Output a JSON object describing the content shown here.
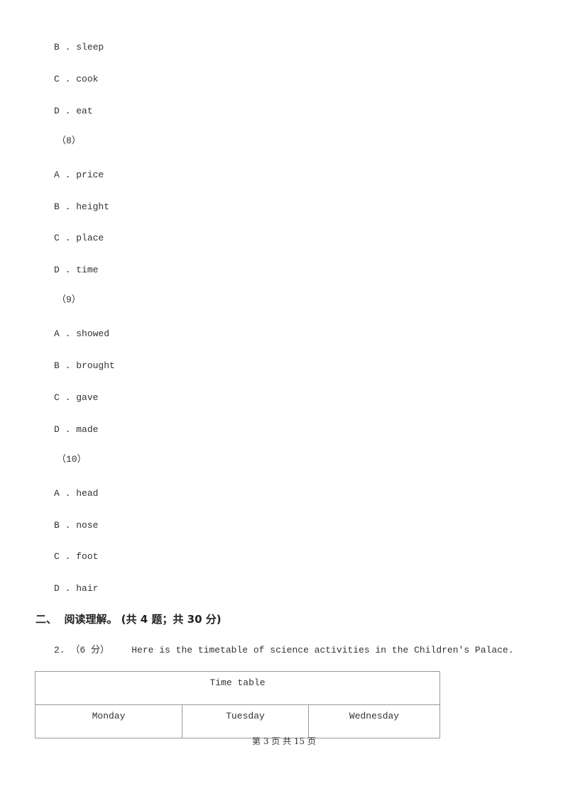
{
  "questions": [
    {
      "options": [
        {
          "letter": "B .",
          "text": "sleep"
        },
        {
          "letter": "C .",
          "text": "cook"
        },
        {
          "letter": "D .",
          "text": "eat"
        }
      ]
    },
    {
      "number": "（8）",
      "options": [
        {
          "letter": "A .",
          "text": "price"
        },
        {
          "letter": "B .",
          "text": "height"
        },
        {
          "letter": "C .",
          "text": "place"
        },
        {
          "letter": "D .",
          "text": "time"
        }
      ]
    },
    {
      "number": "（9）",
      "options": [
        {
          "letter": "A .",
          "text": "showed"
        },
        {
          "letter": "B .",
          "text": "brought"
        },
        {
          "letter": "C .",
          "text": "gave"
        },
        {
          "letter": "D .",
          "text": "made"
        }
      ]
    },
    {
      "number": "（10）",
      "options": [
        {
          "letter": "A .",
          "text": "head"
        },
        {
          "letter": "B .",
          "text": "nose"
        },
        {
          "letter": "C .",
          "text": "foot"
        },
        {
          "letter": "D .",
          "text": "hair"
        }
      ]
    }
  ],
  "section": {
    "heading": "二、  阅读理解。 (共 4 题；共 30 分)"
  },
  "question2": {
    "number": "2.",
    "points": "（6 分）",
    "prompt": "Here is the timetable of science activities in the Children's Palace."
  },
  "timetable": {
    "title": "Time table",
    "days": [
      "Monday",
      "Tuesday",
      "Wednesday"
    ]
  },
  "footer": {
    "page_text": "第 3 页 共 15 页"
  }
}
